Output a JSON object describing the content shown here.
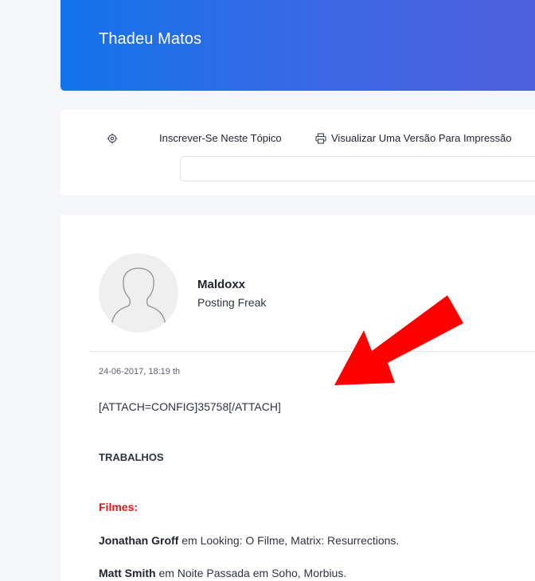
{
  "header": {
    "title": "Thadeu Matos"
  },
  "toolbar": {
    "subscribe_label": "Inscrever-Se Neste Tópico",
    "print_label": "Visualizar Uma Versão Para Impressão",
    "search": {
      "value": "",
      "placeholder": ""
    },
    "icons": [
      "gear-icon",
      "printer-icon"
    ]
  },
  "post": {
    "author": {
      "name": "Maldoxx",
      "title": "Posting Freak"
    },
    "date": "24-06-2017, 18:19 th",
    "attach_text": "[ATTACH=CONFIG]35758[/ATTACH]",
    "section_title": "TRABALHOS",
    "category": "Filmes:",
    "credits": [
      {
        "actor": "Jonathan Groff",
        "text": " em Looking: O Filme, Matrix: Resurrections."
      },
      {
        "actor": "Matt Smith",
        "text": " em Noite Passada em Soho, Morbius."
      }
    ]
  },
  "colors": {
    "header_gradient_start": "#1273ea",
    "header_gradient_end": "#5060dc",
    "category_red": "#ee1111",
    "arrow_red": "#ff0000"
  }
}
